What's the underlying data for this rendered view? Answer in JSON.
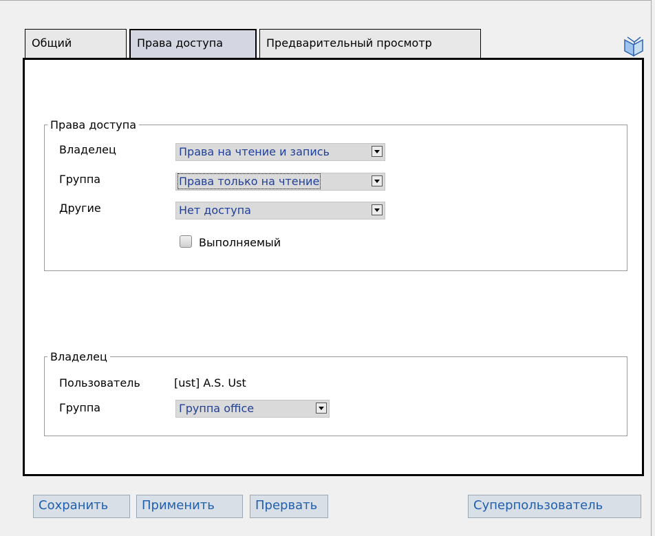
{
  "tabs": [
    {
      "label": "Общий"
    },
    {
      "label": "Права доступа"
    },
    {
      "label": "Предварительный просмотр"
    }
  ],
  "permissions": {
    "legend": "Права доступа",
    "owner_label": "Владелец",
    "owner_value": "Права на чтение и запись",
    "group_label": "Группа",
    "group_value": "Права только на чтение",
    "others_label": "Другие",
    "others_value": "Нет доступа",
    "executable_label": "Выполняемый",
    "executable_checked": false
  },
  "ownership": {
    "legend": "Владелец",
    "user_label": "Пользователь",
    "user_value": "[ust] A.S. Ust",
    "group_label": "Группа",
    "group_value": "Группа office"
  },
  "buttons": {
    "save": "Сохранить",
    "apply": "Применить",
    "abort": "Прервать",
    "superuser": "Суперпользователь"
  },
  "icons": {
    "help": "book-icon"
  },
  "colors": {
    "active_tab": "#d4d7e2",
    "select_text": "#1f3f98",
    "button_text": "#1f5fb0",
    "button_bg": "#d8dfe6"
  }
}
